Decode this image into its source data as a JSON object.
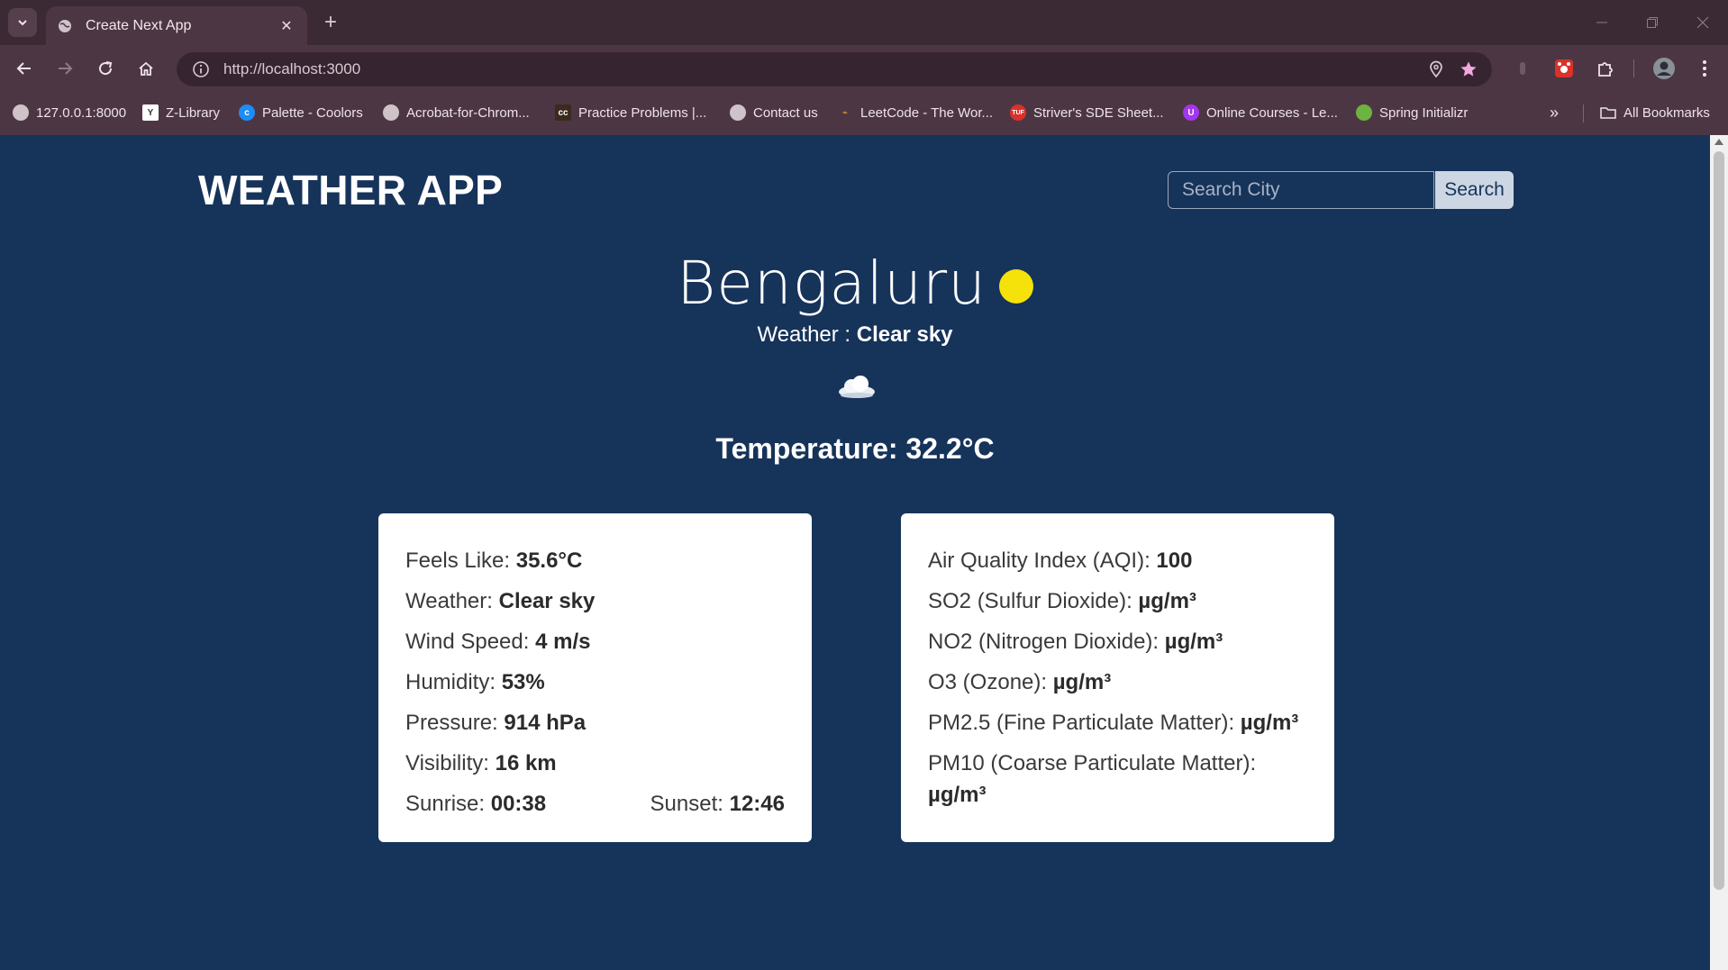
{
  "browser": {
    "tab_title": "Create Next App",
    "url": "http://localhost:3000"
  },
  "bookmarks": [
    {
      "label": "127.0.0.1:8000",
      "icon": "globe-icon"
    },
    {
      "label": "Z-Library",
      "icon": "zlibrary-icon"
    },
    {
      "label": "Palette - Coolors",
      "icon": "coolors-icon"
    },
    {
      "label": "Acrobat-for-Chrom...",
      "icon": "globe-icon"
    },
    {
      "label": "Practice Problems |...",
      "icon": "codechef-icon"
    },
    {
      "label": "Contact us",
      "icon": "globe-icon"
    },
    {
      "label": "LeetCode - The Wor...",
      "icon": "leetcode-icon"
    },
    {
      "label": "Striver's SDE Sheet...",
      "icon": "tuf-icon"
    },
    {
      "label": "Online Courses - Le...",
      "icon": "udemy-icon"
    },
    {
      "label": "Spring Initializr",
      "icon": "spring-icon"
    }
  ],
  "all_bookmarks": "All Bookmarks",
  "app": {
    "title": "WEATHER APP",
    "search_placeholder": "Search City",
    "search_button": "Search",
    "city": "Bengaluru",
    "weather_label": "Weather : ",
    "weather_value": "Clear sky",
    "temperature_label": "Temperature: ",
    "temperature_value": "32.2°C"
  },
  "details": {
    "feels_like_label": "Feels Like: ",
    "feels_like": "35.6°C",
    "weather_label": "Weather: ",
    "weather": "Clear sky",
    "wind_label": "Wind Speed: ",
    "wind": "4 m/s",
    "humidity_label": "Humidity: ",
    "humidity": "53%",
    "pressure_label": "Pressure: ",
    "pressure": "914 hPa",
    "visibility_label": "Visibility: ",
    "visibility": "16 km",
    "sunrise_label": "Sunrise: ",
    "sunrise": "00:38",
    "sunset_label": "Sunset: ",
    "sunset": "12:46"
  },
  "air": {
    "aqi_label": "Air Quality Index (AQI): ",
    "aqi": "100",
    "so2_label": "SO2 (Sulfur Dioxide): ",
    "so2_unit": "µg/m³",
    "no2_label": "NO2 (Nitrogen Dioxide): ",
    "no2_unit": "µg/m³",
    "o3_label": "O3 (Ozone): ",
    "o3_unit": "µg/m³",
    "pm25_label": "PM2.5 (Fine Particulate Matter): ",
    "pm25_unit": "µg/m³",
    "pm10_label": "PM10 (Coarse Particulate Matter): ",
    "pm10_unit": "µg/m³"
  },
  "colors": {
    "page_background": "#16335a",
    "card_background": "#ffffff",
    "sun": "#f5e20a",
    "browser_frame": "#4d3643"
  }
}
